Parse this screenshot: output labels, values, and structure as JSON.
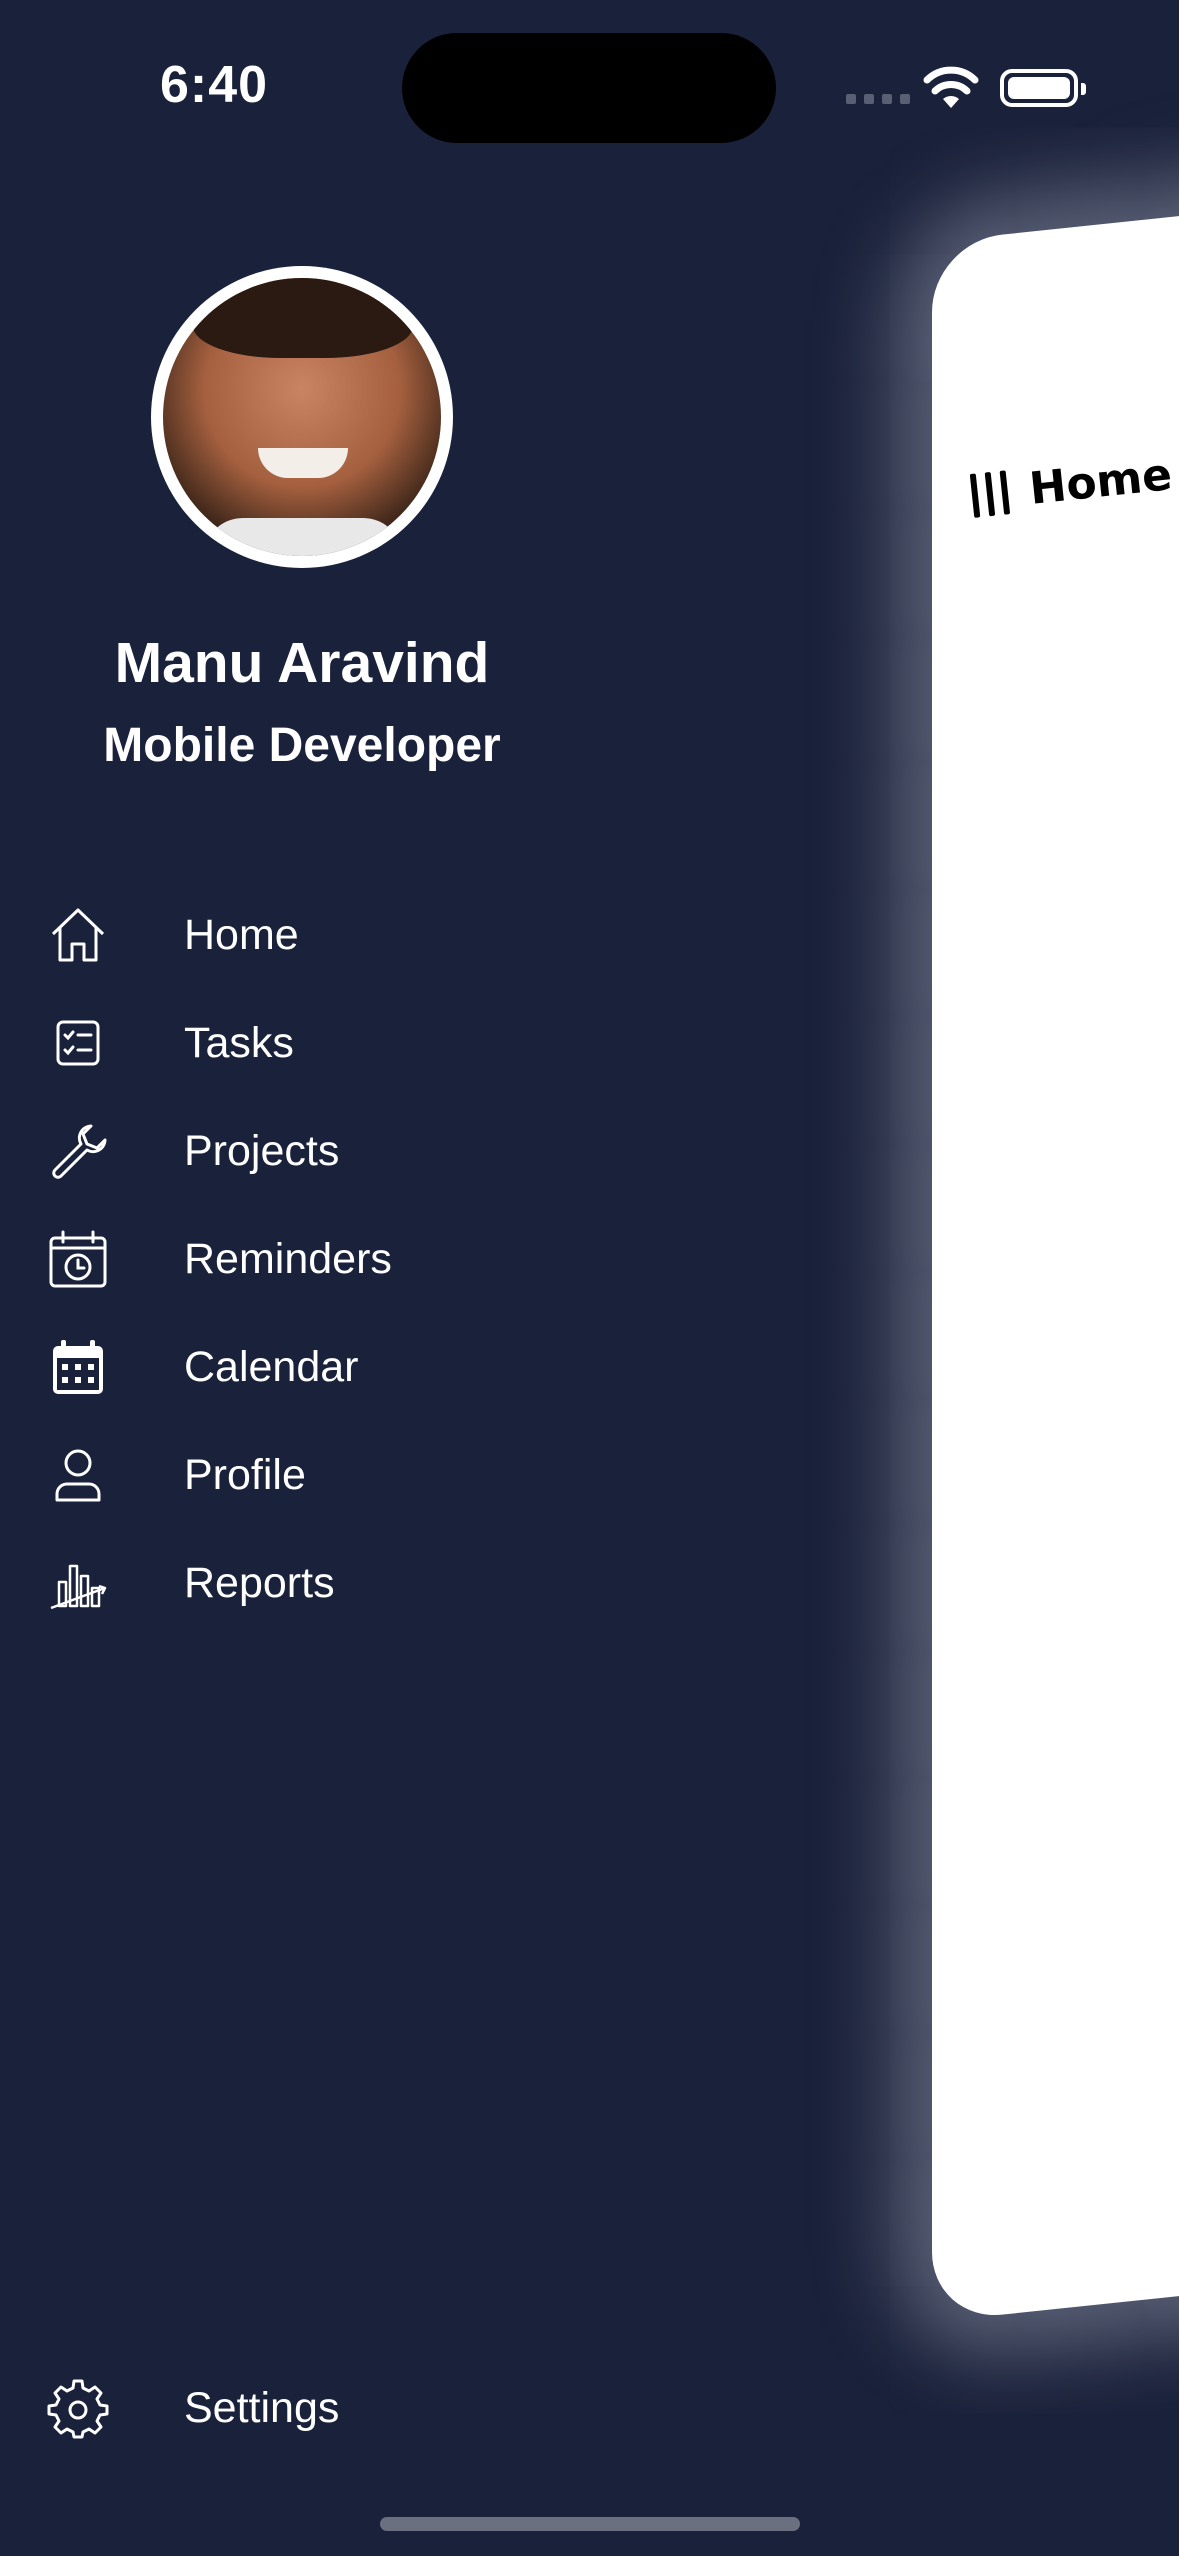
{
  "status_bar": {
    "time": "6:40"
  },
  "main_panel": {
    "title": "Home",
    "menu_icon": "menu-icon"
  },
  "profile": {
    "name": "Manu Aravind",
    "role": "Mobile Developer"
  },
  "nav": {
    "items": [
      {
        "label": "Home",
        "icon": "home-icon"
      },
      {
        "label": "Tasks",
        "icon": "checklist-icon"
      },
      {
        "label": "Projects",
        "icon": "wrench-icon"
      },
      {
        "label": "Reminders",
        "icon": "calendar-clock-icon"
      },
      {
        "label": "Calendar",
        "icon": "calendar-icon"
      },
      {
        "label": "Profile",
        "icon": "person-icon"
      },
      {
        "label": "Reports",
        "icon": "chart-icon"
      }
    ],
    "settings": {
      "label": "Settings",
      "icon": "gear-icon"
    }
  },
  "colors": {
    "background": "#1a213a",
    "panel": "#ffffff",
    "text": "#ffffff"
  }
}
